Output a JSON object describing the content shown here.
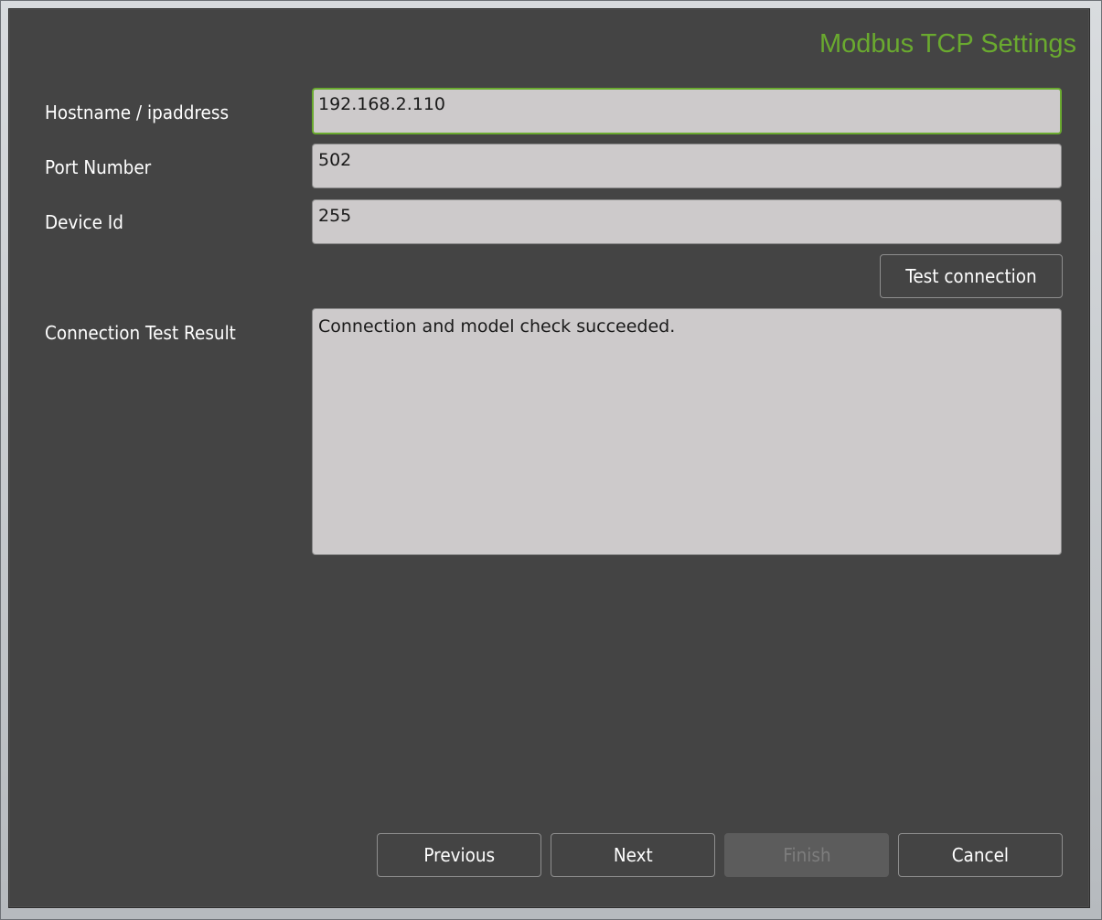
{
  "title": "Modbus TCP Settings",
  "fields": {
    "hostname": {
      "label": "Hostname / ipaddress",
      "value": "192.168.2.110"
    },
    "port": {
      "label": "Port Number",
      "value": "502"
    },
    "device_id": {
      "label": "Device Id",
      "value": "255"
    }
  },
  "test_button_label": "Test connection",
  "result": {
    "label": "Connection Test Result",
    "text": "Connection and model check succeeded."
  },
  "footer": {
    "previous": "Previous",
    "next": "Next",
    "finish": "Finish",
    "cancel": "Cancel"
  },
  "colors": {
    "accent": "#6aaa2f",
    "background": "#444444",
    "field": "#cdcacb"
  }
}
